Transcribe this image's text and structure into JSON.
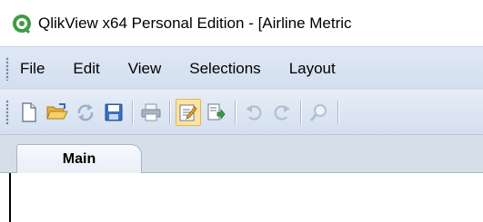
{
  "window": {
    "title": "QlikView x64 Personal Edition - [Airline Metric"
  },
  "menu": {
    "items": [
      {
        "label": "File"
      },
      {
        "label": "Edit"
      },
      {
        "label": "View"
      },
      {
        "label": "Selections"
      },
      {
        "label": "Layout"
      }
    ]
  },
  "toolbar": {
    "buttons": [
      {
        "icon": "new-document-icon"
      },
      {
        "icon": "open-folder-icon"
      },
      {
        "icon": "reload-icon"
      },
      {
        "icon": "save-icon"
      },
      {
        "icon": "print-icon"
      },
      {
        "icon": "edit-script-icon",
        "active": true
      },
      {
        "icon": "reload-data-icon"
      },
      {
        "icon": "undo-icon"
      },
      {
        "icon": "redo-icon"
      },
      {
        "icon": "search-icon"
      }
    ]
  },
  "tabs": [
    {
      "label": "Main",
      "selected": true
    }
  ],
  "colors": {
    "accent_green": "#3f9b46",
    "menubar_bg": "#d2deef",
    "active_button_bg": "#fbe3a2"
  }
}
